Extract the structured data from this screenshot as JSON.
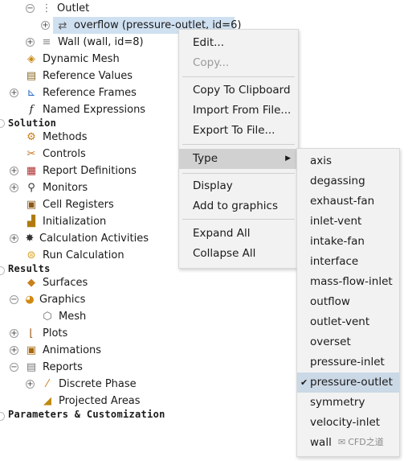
{
  "tree": {
    "outlet": "Outlet",
    "overflow": "overflow (pressure-outlet, id=6)",
    "wall": "Wall (wall, id=8)",
    "dynamic_mesh": "Dynamic Mesh",
    "reference_values": "Reference Values",
    "reference_frames": "Reference Frames",
    "named_expressions": "Named Expressions",
    "solution": "Solution",
    "methods": "Methods",
    "controls": "Controls",
    "report_definitions": "Report Definitions",
    "monitors": "Monitors",
    "cell_registers": "Cell Registers",
    "initialization": "Initialization",
    "calculation_activities": "Calculation Activities",
    "run_calculation": "Run Calculation",
    "results": "Results",
    "surfaces": "Surfaces",
    "graphics": "Graphics",
    "mesh": "Mesh",
    "plots": "Plots",
    "animations": "Animations",
    "reports": "Reports",
    "discrete_phase": "Discrete Phase",
    "projected_areas": "Projected Areas",
    "parameters": "Parameters & Customization"
  },
  "context_menu": {
    "edit": "Edit...",
    "copy": "Copy...",
    "copy_clipboard": "Copy To Clipboard",
    "import_file": "Import From File...",
    "export_file": "Export To File...",
    "type": "Type",
    "display": "Display",
    "add_graphics": "Add to graphics",
    "expand_all": "Expand All",
    "collapse_all": "Collapse All"
  },
  "type_submenu": {
    "items": [
      "axis",
      "degassing",
      "exhaust-fan",
      "inlet-vent",
      "intake-fan",
      "interface",
      "mass-flow-inlet",
      "outflow",
      "outlet-vent",
      "overset",
      "pressure-inlet",
      "pressure-outlet",
      "symmetry",
      "velocity-inlet",
      "wall"
    ],
    "selected": "pressure-outlet"
  },
  "watermark": "CFD之道",
  "colors": {
    "selection": "#cfe0f1",
    "menu_bg": "#f2f2f2",
    "submenu_highlight": "#cbd8e6"
  }
}
